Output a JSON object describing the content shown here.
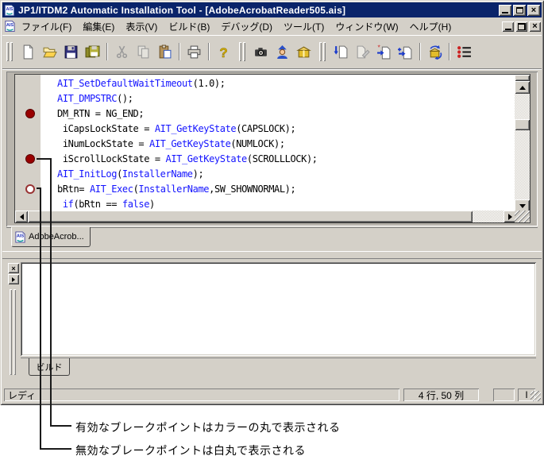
{
  "window": {
    "title": "JP1/ITDM2 Automatic Installation Tool - [AdobeAcrobatReader505.ais]",
    "title_icon": "ais-app-icon",
    "controls": [
      "minimize",
      "maximize",
      "close"
    ],
    "mdi_controls": [
      "mdi-minimize",
      "mdi-restore",
      "mdi-close"
    ]
  },
  "menu": {
    "items": [
      "ファイル(F)",
      "編集(E)",
      "表示(V)",
      "ビルド(B)",
      "デバッグ(D)",
      "ツール(T)",
      "ウィンドウ(W)",
      "ヘルプ(H)"
    ]
  },
  "toolbar": {
    "icons": [
      "new-document-icon",
      "open-folder-icon",
      "save-icon",
      "save-all-icon",
      "cut-icon",
      "copy-icon",
      "paste-icon",
      "print-icon",
      "help-icon",
      "capture-icon",
      "wizard-icon",
      "package-icon",
      "export-document-icon",
      "edit-document-icon",
      "new-step-document-icon",
      "add-step-document-icon",
      "build-package-icon",
      "breakpoint-list-icon"
    ]
  },
  "editor": {
    "colors": {
      "function_blue": "#1414ff",
      "plain_black": "#000000",
      "breakpoint_enabled": "#990000",
      "breakpoint_disabled_fill": "#ffffff"
    },
    "lines": [
      {
        "breakpoint": "none",
        "segments": [
          {
            "style": "function",
            "text": "AIT_SetDefaultWaitTimeout"
          },
          {
            "style": "plain",
            "text": "(1.0);"
          }
        ]
      },
      {
        "breakpoint": "none",
        "segments": [
          {
            "style": "function",
            "text": "AIT_DMPSTRC"
          },
          {
            "style": "plain",
            "text": "();"
          }
        ]
      },
      {
        "breakpoint": "enabled",
        "segments": [
          {
            "style": "plain",
            "text": "DM_RTN = NG_END;"
          }
        ]
      },
      {
        "breakpoint": "none",
        "segments": [
          {
            "style": "plain",
            "text": " iCapsLockState = "
          },
          {
            "style": "function",
            "text": "AIT_GetKeyState"
          },
          {
            "style": "plain",
            "text": "(CAPSLOCK);"
          }
        ]
      },
      {
        "breakpoint": "none",
        "segments": [
          {
            "style": "plain",
            "text": " iNumLockState = "
          },
          {
            "style": "function",
            "text": "AIT_GetKeyState"
          },
          {
            "style": "plain",
            "text": "(NUMLOCK);"
          }
        ]
      },
      {
        "breakpoint": "enabled",
        "segments": [
          {
            "style": "plain",
            "text": " iScrollLockState = "
          },
          {
            "style": "function",
            "text": "AIT_GetKeyState"
          },
          {
            "style": "plain",
            "text": "(SCROLLLOCK);"
          }
        ]
      },
      {
        "breakpoint": "none",
        "segments": [
          {
            "style": "function",
            "text": "AIT_InitLog"
          },
          {
            "style": "plain",
            "text": "("
          },
          {
            "style": "function",
            "text": "InstallerName"
          },
          {
            "style": "plain",
            "text": ");"
          }
        ]
      },
      {
        "breakpoint": "disabled",
        "segments": [
          {
            "style": "plain",
            "text": "bRtn= "
          },
          {
            "style": "function",
            "text": "AIT_Exec"
          },
          {
            "style": "plain",
            "text": "("
          },
          {
            "style": "function",
            "text": "InstallerName"
          },
          {
            "style": "plain",
            "text": ",SW_SHOWNORMAL);"
          }
        ]
      },
      {
        "breakpoint": "none",
        "segments": [
          {
            "style": "plain",
            "text": " "
          },
          {
            "style": "function",
            "text": "if"
          },
          {
            "style": "plain",
            "text": "(bRtn == "
          },
          {
            "style": "function",
            "text": "false"
          },
          {
            "style": "plain",
            "text": ")"
          }
        ]
      }
    ]
  },
  "doc_tab": {
    "label": "AdobeAcrob...",
    "icon": "ais-document-icon"
  },
  "output": {
    "tab_label": "ビルド"
  },
  "status": {
    "ready": "レディ",
    "position": "4 行, 50 列",
    "indicator": "I"
  },
  "annotations": {
    "enabled_note": "有効なブレークポイントはカラーの丸で表示される",
    "disabled_note": "無効なブレークポイントは白丸で表示される"
  }
}
